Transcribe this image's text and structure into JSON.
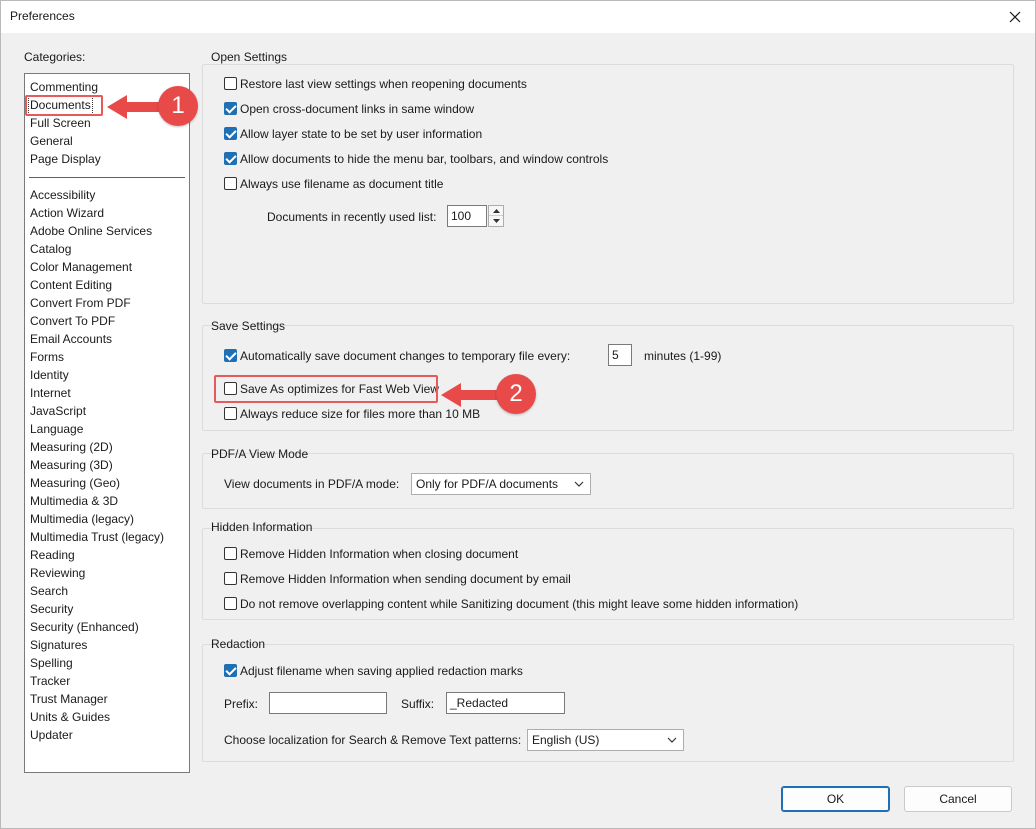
{
  "window": {
    "title": "Preferences"
  },
  "categories": {
    "label": "Categories:",
    "top_items": [
      "Commenting",
      "Documents",
      "Full Screen",
      "General",
      "Page Display"
    ],
    "selected": "Documents",
    "items": [
      "Accessibility",
      "Action Wizard",
      "Adobe Online Services",
      "Catalog",
      "Color Management",
      "Content Editing",
      "Convert From PDF",
      "Convert To PDF",
      "Email Accounts",
      "Forms",
      "Identity",
      "Internet",
      "JavaScript",
      "Language",
      "Measuring (2D)",
      "Measuring (3D)",
      "Measuring (Geo)",
      "Multimedia & 3D",
      "Multimedia (legacy)",
      "Multimedia Trust (legacy)",
      "Reading",
      "Reviewing",
      "Search",
      "Security",
      "Security (Enhanced)",
      "Signatures",
      "Spelling",
      "Tracker",
      "Trust Manager",
      "Units & Guides",
      "Updater"
    ]
  },
  "open_settings": {
    "title": "Open Settings",
    "options": [
      {
        "label": "Restore last view settings when reopening documents",
        "checked": false
      },
      {
        "label": "Open cross-document links in same window",
        "checked": true
      },
      {
        "label": "Allow layer state to be set by user information",
        "checked": true
      },
      {
        "label": "Allow documents to hide the menu bar, toolbars, and window controls",
        "checked": true
      },
      {
        "label": "Always use filename as document title",
        "checked": false
      }
    ],
    "recent_label": "Documents in recently used list:",
    "recent_value": "100"
  },
  "save_settings": {
    "title": "Save Settings",
    "autosave_label": "Automatically save document changes to temporary file every:",
    "autosave_checked": true,
    "autosave_value": "5",
    "autosave_units": "minutes (1-99)",
    "fast_web_label": "Save As optimizes for Fast Web View",
    "fast_web_checked": false,
    "reduce_label": "Always reduce size for files more than 10 MB",
    "reduce_checked": false
  },
  "pdfa": {
    "title": "PDF/A View Mode",
    "label": "View documents in PDF/A mode:",
    "value": "Only for PDF/A documents"
  },
  "hidden_info": {
    "title": "Hidden Information",
    "options": [
      {
        "label": "Remove Hidden Information when closing document",
        "checked": false
      },
      {
        "label": "Remove Hidden Information when sending document by email",
        "checked": false
      },
      {
        "label": "Do not remove overlapping content while Sanitizing document (this might leave some hidden information)",
        "checked": false
      }
    ]
  },
  "redaction": {
    "title": "Redaction",
    "adjust_label": "Adjust filename when saving applied redaction marks",
    "adjust_checked": true,
    "prefix_label": "Prefix:",
    "prefix_value": "",
    "suffix_label": "Suffix:",
    "suffix_value": "_Redacted",
    "locale_label": "Choose localization for Search & Remove Text patterns:",
    "locale_value": "English (US)"
  },
  "buttons": {
    "ok": "OK",
    "cancel": "Cancel"
  },
  "annotations": {
    "step1": "1",
    "step2": "2",
    "color": "#e84a4a"
  },
  "colors": {
    "accent": "#1f6fb5",
    "highlight": "#e85a5a"
  }
}
